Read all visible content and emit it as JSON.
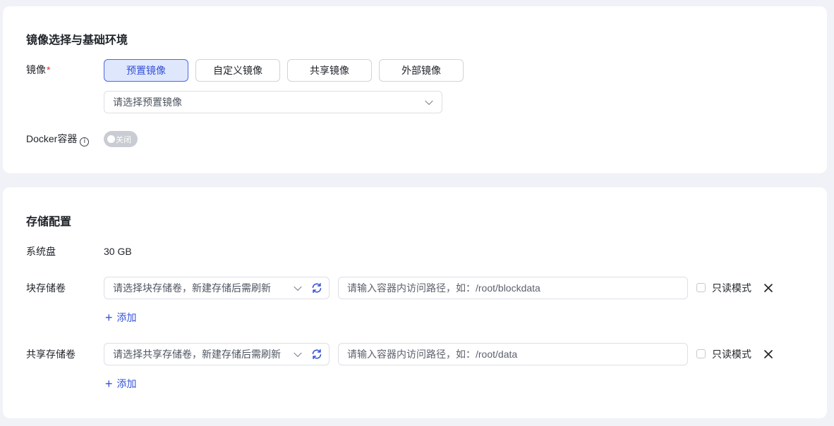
{
  "image_section": {
    "title": "镜像选择与基础环境",
    "image_label": "镜像",
    "required_mark": "*",
    "tabs": [
      "预置镜像",
      "自定义镜像",
      "共享镜像",
      "外部镜像"
    ],
    "active_tab": "预置镜像",
    "select_placeholder": "请选择预置镜像",
    "docker_label": "Docker容器",
    "docker_info_glyph": "i",
    "docker_toggle_text": "关闭",
    "docker_enabled": false
  },
  "storage_section": {
    "title": "存储配置",
    "system_disk_label": "系统盘",
    "system_disk_value": "30 GB",
    "block": {
      "label": "块存储卷",
      "select_placeholder": "请选择块存储卷，新建存储后需刷新",
      "path_placeholder": "请输入容器内访问路径，如：/root/blockdata",
      "readonly_label": "只读模式",
      "readonly_checked": false,
      "add_label": "添加"
    },
    "shared": {
      "label": "共享存储卷",
      "select_placeholder": "请选择共享存储卷，新建存储后需刷新",
      "path_placeholder": "请输入容器内访问路径，如：/root/data",
      "readonly_label": "只读模式",
      "readonly_checked": false,
      "add_label": "添加"
    }
  },
  "colors": {
    "accent": "#3552d6",
    "active_tab_bg": "#dfe7fd",
    "required": "#e0302e",
    "page_bg": "#f0f2f7"
  },
  "icons": {
    "select_arrow": "chevron-down-icon",
    "refresh": "refresh-icon",
    "remove": "close-icon",
    "add": "plus-icon",
    "info": "info-icon"
  }
}
